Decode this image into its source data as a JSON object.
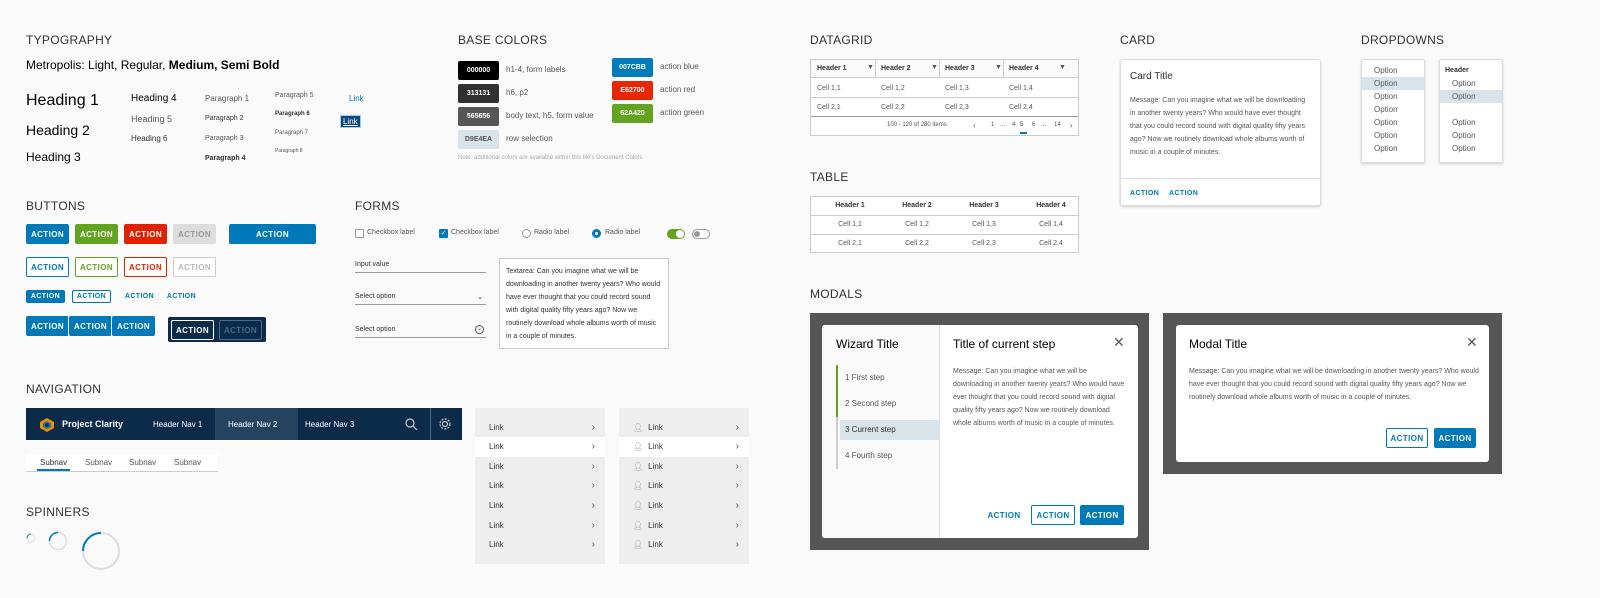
{
  "typography": {
    "section": "TYPOGRAPHY",
    "font_line": {
      "prefix": "Metropolis:",
      "light": "Light,",
      "regular": "Regular,",
      "medium": "Medium,",
      "semibold": "Semi Bold"
    },
    "h1": "Heading 1",
    "h2": "Heading 2",
    "h3": "Heading 3",
    "h4": "Heading 4",
    "h5": "Heading 5",
    "h6": "Heading 6",
    "p1": "Paragraph 1",
    "p2": "Paragraph 2",
    "p3": "Paragraph 3",
    "p4": "Paragraph 4",
    "p5": "Paragraph 5",
    "p6": "Paragraph 6",
    "p7": "Paragraph 7",
    "p8": "Paragraph 8",
    "link": "Link",
    "link_active": "Link"
  },
  "colors": {
    "section": "BASE COLORS",
    "swatches": [
      {
        "hex": "000000",
        "label": "h1-4, form labels",
        "color": "#000000"
      },
      {
        "hex": "313131",
        "label": "h6, p2",
        "color": "#313131"
      },
      {
        "hex": "565656",
        "label": "body text, h5, form value",
        "color": "#565656"
      },
      {
        "hex": "D9E4EA",
        "label": "row selection",
        "color": "#D9E4EA"
      },
      {
        "hex": "007CBB",
        "label": "action blue",
        "color": "#007CBB"
      },
      {
        "hex": "E62700",
        "label": "action red",
        "color": "#E62700"
      },
      {
        "hex": "62A420",
        "label": "action green",
        "color": "#62A420"
      }
    ],
    "note": "Note: additional colors are available within this file's Document Colors"
  },
  "buttons": {
    "section": "BUTTONS",
    "label": "ACTION"
  },
  "forms": {
    "section": "FORMS",
    "checkbox1": "Checkbox label",
    "checkbox2": "Checkbox label",
    "radio1": "Radio label",
    "radio2": "Radio label",
    "input_value": "Input value",
    "select1": "Select option",
    "select2": "Select option",
    "textarea": "Textarea: Can you imagine what we will be downloading in another twenty years? Who would have ever thought that you could record sound with digital quality fifty years ago? Now we routinely download whole albums worth of music in a couple of minutes."
  },
  "navigation": {
    "section": "NAVIGATION",
    "brand": "Project Clarity",
    "nav1": "Header Nav 1",
    "nav2": "Header Nav 2",
    "nav3": "Header Nav 3",
    "subnav": [
      "Subnav",
      "Subnav",
      "Subnav",
      "Subnav"
    ],
    "vlinks": [
      "Link",
      "Link",
      "Link",
      "Link",
      "Link",
      "Link",
      "Link"
    ]
  },
  "spinners": {
    "section": "SPINNERS"
  },
  "datagrid": {
    "section": "DATAGRID",
    "headers": [
      "Header 1",
      "Header 2",
      "Header 3",
      "Header 4"
    ],
    "rows": [
      [
        "Cell 1,1",
        "Cell 1,2",
        "Cell 1,3",
        "Cell 1,4"
      ],
      [
        "Cell 2,1",
        "Cell 2,2",
        "Cell 2,3",
        "Cell 2,4"
      ]
    ],
    "footer": "100 - 120 of 280 items",
    "pages": [
      "1",
      "...",
      "4",
      "5",
      "6",
      "...",
      "14"
    ]
  },
  "table": {
    "section": "TABLE",
    "headers": [
      "Header 1",
      "Header 2",
      "Header 3",
      "Header 4"
    ],
    "rows": [
      [
        "Cell 1,1",
        "Cell 1,2",
        "Cell 1,3",
        "Cell 1,4"
      ],
      [
        "Cell 2,1",
        "Cell 2,2",
        "Cell 2,3",
        "Cell 2,4"
      ]
    ]
  },
  "card": {
    "section": "CARD",
    "title": "Card Title",
    "message": "Message: Can you imagine what we will be downloading in another twenty years? Who would have ever thought that you could record sound with digital quality fifty years ago? Now we routinely download whole albums worth of music in a couple of minutes.",
    "action1": "ACTION",
    "action2": "ACTION"
  },
  "dropdowns": {
    "section": "DROPDOWNS",
    "options": [
      "Option",
      "Option",
      "Option",
      "Option",
      "Option",
      "Option",
      "Option",
      "Option"
    ],
    "header": "Header",
    "option": "Option"
  },
  "modals": {
    "section": "MODALS",
    "wizard_title": "Wizard Title",
    "steps": [
      "1  First step",
      "2  Second step",
      "3  Current step",
      "4  Fourth step"
    ],
    "step_title": "Title of current step",
    "message": "Message: Can you imagine what we will be downloading in another twenty years? Who would have ever thought that you could record sound with digital quality fifty years ago? Now we routinely download whole albums worth of music in a couple of minutes.",
    "modal_title": "Modal Title",
    "modal_message": "Message: Can you imagine what we will be downloading in another twenty years? Who would have ever thought that you could record sound with digital quality fifty years ago? Now we routinely download whole albums worth of music in a couple of minutes.",
    "action": "ACTION"
  }
}
